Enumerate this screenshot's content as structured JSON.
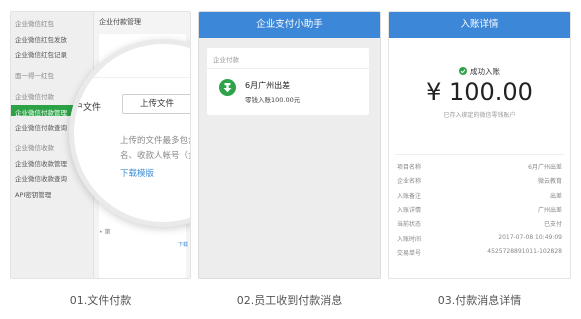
{
  "panel1": {
    "sidebar": [
      {
        "label": "企业微信红包",
        "section": true
      },
      {
        "label": "企业微信红包发放",
        "section": false
      },
      {
        "label": "企业微信红包记录",
        "section": false
      },
      {
        "label": "面一得一红包",
        "section": true
      },
      {
        "label": "企业微信付款",
        "section": true
      },
      {
        "label": "企业微信付款管理",
        "section": false,
        "active": true
      },
      {
        "label": "企业微信付款查询",
        "section": false
      },
      {
        "label": "企业微信收款",
        "section": true
      },
      {
        "label": "企业微信收款管理",
        "section": false
      },
      {
        "label": "企业微信收款查询",
        "section": false
      },
      {
        "label": "API密钥管理",
        "section": false
      }
    ],
    "main_title": "企业付款管理",
    "magnifier": {
      "field_label": "户文件",
      "upload_button": "上传文件",
      "hint_line1": "上传的文件最多包含",
      "hint_line2": "名、收款人帐号（企",
      "download_link": "下载模版"
    },
    "small_upload": "上传",
    "small_download": "下载",
    "bullet": "• 第"
  },
  "panel2": {
    "title": "企业支付小助手",
    "card_header": "企业付款",
    "item_title": "6月广州出差",
    "item_detail": "零钱入账100.00元",
    "icon": "download-arrow-icon"
  },
  "panel3": {
    "title": "入账详情",
    "status": "成功入账",
    "amount": "¥ 100.00",
    "sub": "已存入绑定的微信零钱账户",
    "rows": [
      {
        "key": "项目名称",
        "value": "6月广州出差"
      },
      {
        "key": "企业名称",
        "value": "微云教育"
      },
      {
        "key": "入账备注",
        "value": "出差"
      },
      {
        "key": "入账详情",
        "value": "广州出差"
      },
      {
        "key": "当前状态",
        "value": "已支付"
      },
      {
        "key": "入账时间",
        "value": "2017-07-08  10:49:09"
      },
      {
        "key": "交易单号",
        "value": "4525728891011-102828"
      }
    ]
  },
  "captions": [
    "01.文件付款",
    "02.员工收到付款消息",
    "03.付款消息详情"
  ],
  "colors": {
    "accent_blue": "#3d87d8",
    "success_green": "#2ea34a",
    "sidebar_active": "#2ba245"
  }
}
